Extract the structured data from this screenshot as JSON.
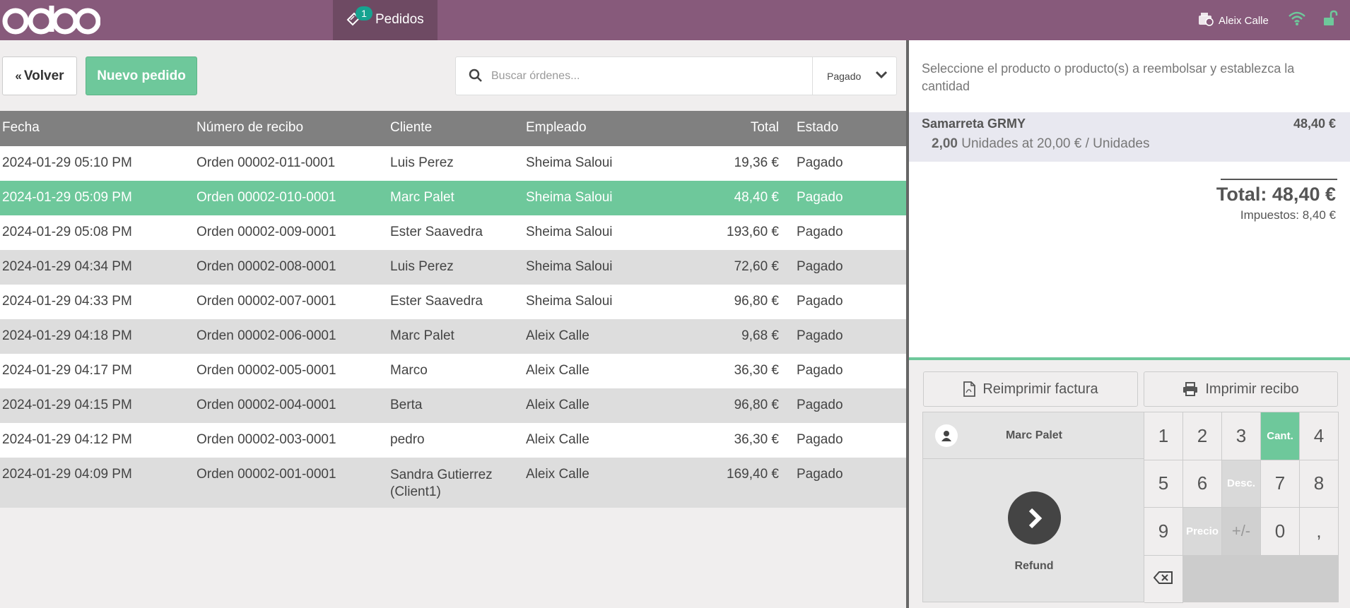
{
  "colors": {
    "brand": "#875a7b",
    "accent": "#6ec89b",
    "badge": "#16a390"
  },
  "topbar": {
    "logo": "odoo",
    "orders_tab": {
      "label": "Pedidos",
      "badge": "1",
      "icon": "ticket-icon"
    },
    "user": {
      "name": "Aleix Calle",
      "icon": "cash-register-icon"
    },
    "wifi_icon": "wifi-icon",
    "lock_icon": "unlock-icon"
  },
  "toolbar": {
    "back_label": "Volver",
    "back_icon": "double-chevron-left-icon",
    "new_order_label": "Nuevo pedido",
    "search_placeholder": "Buscar órdenes...",
    "filter_value": "Pagado"
  },
  "orders": {
    "headers": [
      "Fecha",
      "Número de recibo",
      "Cliente",
      "Empleado",
      "Total",
      "Estado"
    ],
    "rows": [
      {
        "fecha": "2024-01-29 05:10 PM",
        "recibo": "Orden 00002-011-0001",
        "cliente": "Luis Perez",
        "empleado": "Sheima Saloui",
        "total": "19,36 €",
        "estado": "Pagado"
      },
      {
        "fecha": "2024-01-29 05:09 PM",
        "recibo": "Orden 00002-010-0001",
        "cliente": "Marc Palet",
        "empleado": "Sheima Saloui",
        "total": "48,40 €",
        "estado": "Pagado"
      },
      {
        "fecha": "2024-01-29 05:08 PM",
        "recibo": "Orden 00002-009-0001",
        "cliente": "Ester Saavedra",
        "empleado": "Sheima Saloui",
        "total": "193,60 €",
        "estado": "Pagado"
      },
      {
        "fecha": "2024-01-29 04:34 PM",
        "recibo": "Orden 00002-008-0001",
        "cliente": "Luis Perez",
        "empleado": "Sheima Saloui",
        "total": "72,60 €",
        "estado": "Pagado"
      },
      {
        "fecha": "2024-01-29 04:33 PM",
        "recibo": "Orden 00002-007-0001",
        "cliente": "Ester Saavedra",
        "empleado": "Sheima Saloui",
        "total": "96,80 €",
        "estado": "Pagado"
      },
      {
        "fecha": "2024-01-29 04:18 PM",
        "recibo": "Orden 00002-006-0001",
        "cliente": "Marc Palet",
        "empleado": "Aleix Calle",
        "total": "9,68 €",
        "estado": "Pagado"
      },
      {
        "fecha": "2024-01-29 04:17 PM",
        "recibo": "Orden 00002-005-0001",
        "cliente": "Marco",
        "empleado": "Aleix Calle",
        "total": "36,30 €",
        "estado": "Pagado"
      },
      {
        "fecha": "2024-01-29 04:15 PM",
        "recibo": "Orden 00002-004-0001",
        "cliente": "Berta",
        "empleado": "Aleix Calle",
        "total": "96,80 €",
        "estado": "Pagado"
      },
      {
        "fecha": "2024-01-29 04:12 PM",
        "recibo": "Orden 00002-003-0001",
        "cliente": "pedro",
        "empleado": "Aleix Calle",
        "total": "36,30 €",
        "estado": "Pagado"
      },
      {
        "fecha": "2024-01-29 04:09 PM",
        "recibo": "Orden 00002-001-0001",
        "cliente": "Sandra Gutierrez (Client1)",
        "empleado": "Aleix Calle",
        "total": "169,40 €",
        "estado": "Pagado"
      }
    ]
  },
  "detail": {
    "instruction": "Seleccione el producto o producto(s) a reembolsar y establezca la cantidad",
    "line": {
      "product": "Samarreta GRMY",
      "price": "48,40 €",
      "qty": "2,00",
      "detail_rest": " Unidades at 20,00 € / Unidades"
    },
    "total": "Total: 48,40 €",
    "taxes": "Impuestos: 8,40 €"
  },
  "control": {
    "reprint_invoice": "Reimprimir factura",
    "print_receipt": "Imprimir recibo",
    "customer": "Marc Palet",
    "refund_label": "Refund",
    "keys": {
      "k1": "1",
      "k2": "2",
      "k3": "3",
      "mode_qty": "Cant.",
      "k4": "4",
      "k5": "5",
      "k6": "6",
      "mode_disc": "Desc.",
      "k7": "7",
      "k8": "8",
      "k9": "9",
      "mode_price": "Precio",
      "minus": "+/-",
      "k0": "0",
      "comma": ","
    }
  }
}
